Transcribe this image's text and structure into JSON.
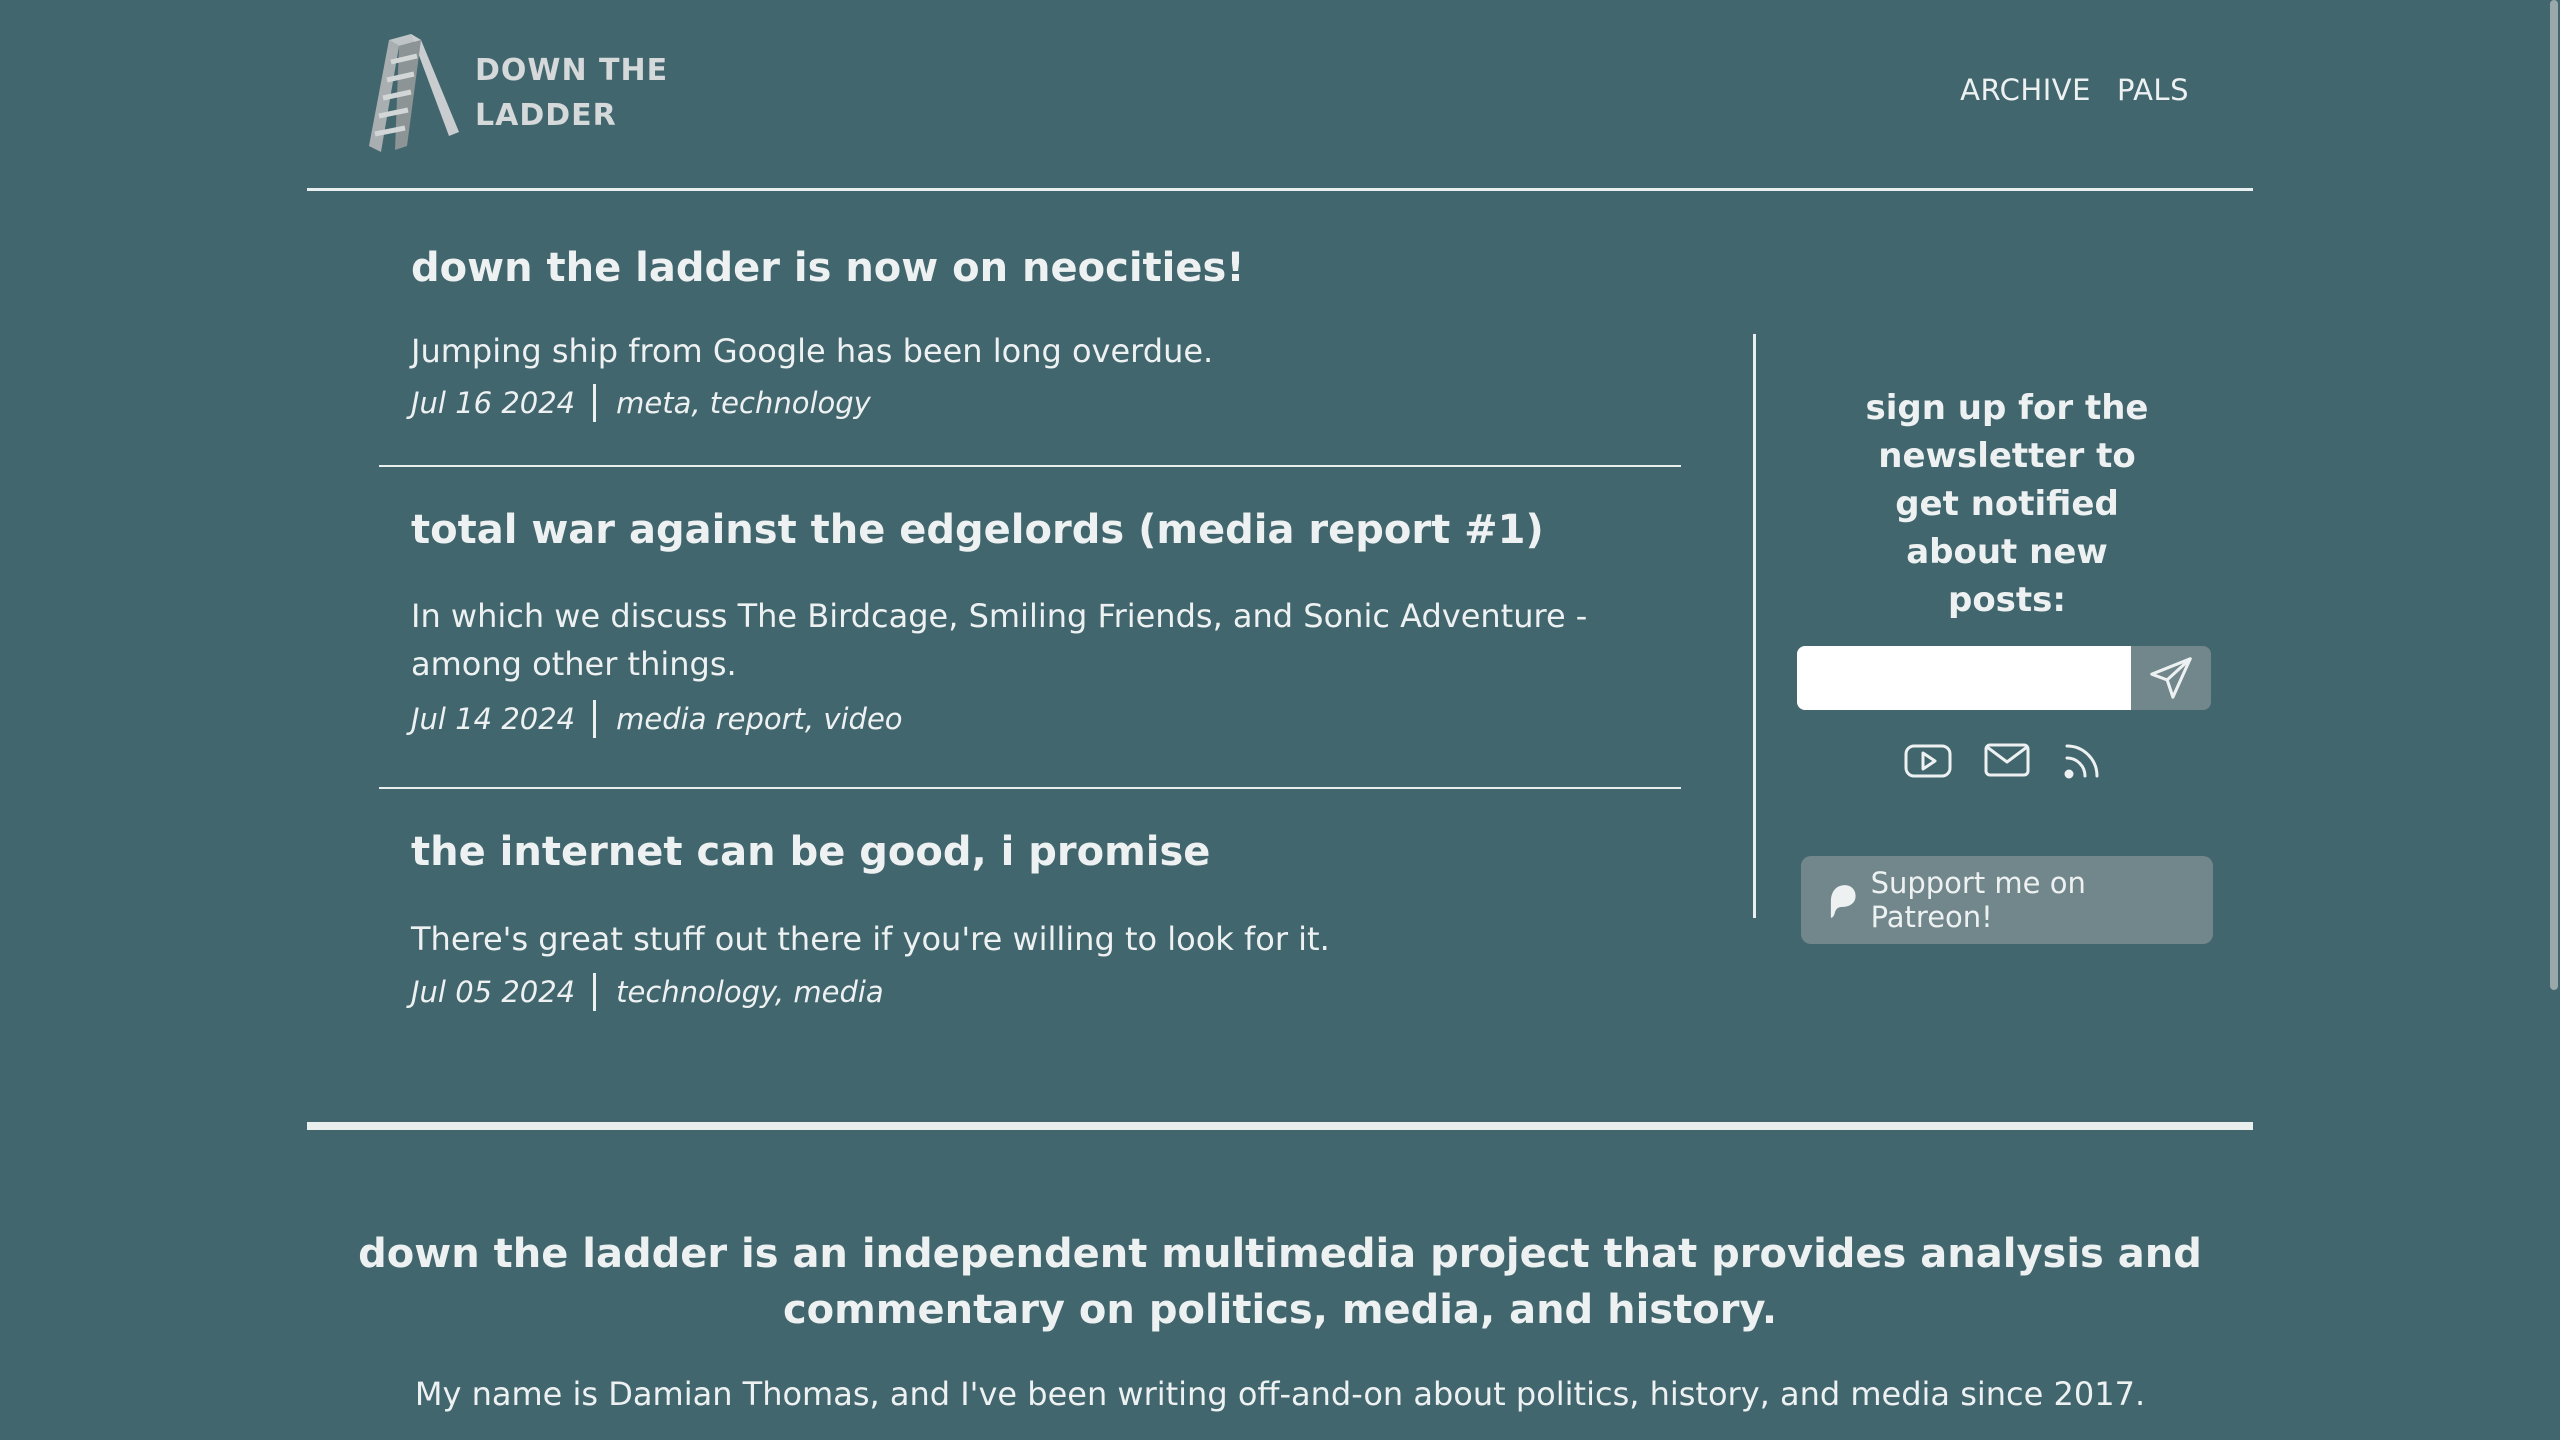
{
  "header": {
    "logo_text": "DOWN THE LADDER",
    "nav": [
      {
        "label": "ARCHIVE"
      },
      {
        "label": "PALS"
      }
    ]
  },
  "posts": [
    {
      "title": "down the ladder is now on neocities!",
      "summary": "Jumping ship from Google has been long overdue.",
      "date": "Jul 16 2024",
      "tags": "meta, technology"
    },
    {
      "title": "total war against the edgelords (media report #1)",
      "summary": "In which we discuss The Birdcage, Smiling Friends, and Sonic Adventure - among other things.",
      "date": "Jul 14 2024",
      "tags": "media report, video"
    },
    {
      "title": "the internet can be good, i promise",
      "summary": "There's great stuff out there if you're willing to look for it.",
      "date": "Jul 05 2024",
      "tags": "technology, media"
    }
  ],
  "sidebar": {
    "newsletter_heading": "sign up for the newsletter to get notified about new posts:",
    "email_value": "",
    "send_icon": "send-icon",
    "social_icons": [
      "youtube-icon",
      "mail-icon",
      "rss-icon"
    ],
    "patreon_label": "Support me on Patreon!"
  },
  "about": {
    "heading": "down the ladder is an independent multimedia project that provides analysis and commentary on politics, media, and history.",
    "text": "My name is Damian Thomas, and I've been writing off-and-on about politics, history, and media since 2017."
  },
  "colors": {
    "background": "#41666e",
    "text": "#eef1f1",
    "button": "#71878c"
  }
}
